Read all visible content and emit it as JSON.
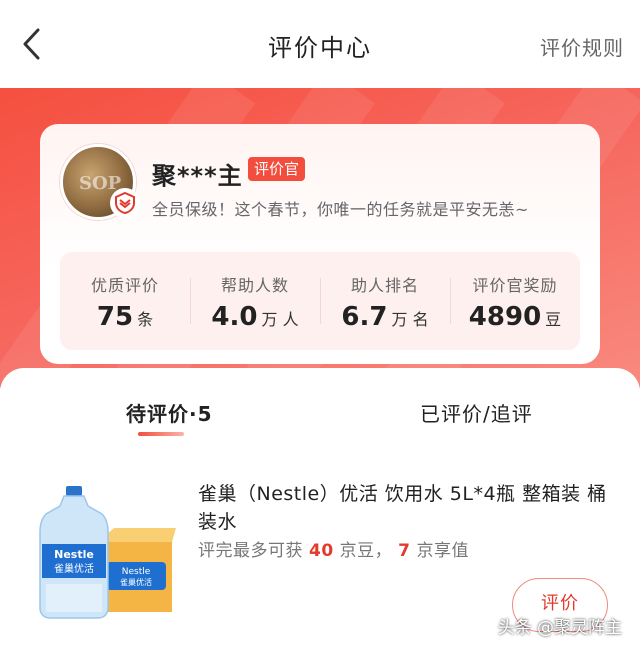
{
  "header": {
    "title": "评价中心",
    "rules_label": "评价规则",
    "back_icon": "chevron-left-icon"
  },
  "profile": {
    "username": "聚***主",
    "role_tag": "评价官",
    "motto": "全员保级！这个春节，你唯一的任务就是平安无恙~",
    "avatar_mark": "SOP",
    "badge_icon": "shield-badge-icon"
  },
  "stats": [
    {
      "label": "优质评价",
      "value": "75",
      "unit": "条"
    },
    {
      "label": "帮助人数",
      "value": "4.0",
      "unit": "万 人"
    },
    {
      "label": "助人排名",
      "value": "6.7",
      "unit": "万 名"
    },
    {
      "label": "评价官奖励",
      "value": "4890",
      "unit": "豆"
    }
  ],
  "tabs": {
    "pending": "待评价·5",
    "done": "已评价/追评"
  },
  "product": {
    "name": "雀巢（Nestle）优活 饮用水 5L*4瓶 整箱装 桶装水",
    "reward_prefix": "评完最多可获",
    "beans": "40",
    "beans_unit": "京豆，",
    "value": "7",
    "value_unit": "京享值",
    "button": "评价",
    "bottle_brand": "Nestle",
    "bottle_sub": "雀巢优活"
  },
  "watermark": "头条 @聚灵阵主",
  "colors": {
    "accent": "#e23b2e",
    "banner": "#f5503f",
    "tag": "#f24d3d"
  }
}
